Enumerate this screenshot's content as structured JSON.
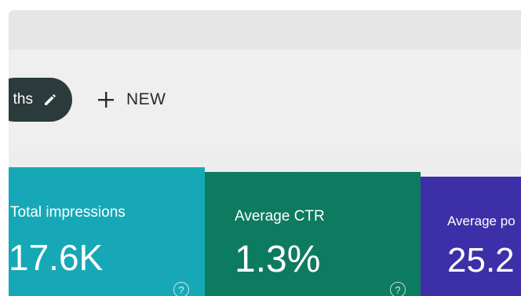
{
  "toolbar": {
    "filter_chip_label": "ths",
    "new_button_label": "NEW"
  },
  "cards": [
    {
      "label": "Total impressions",
      "value": "17.6K",
      "color": "#16a8b7"
    },
    {
      "label": "Average CTR",
      "value": "1.3%",
      "color": "#0d7b5f"
    },
    {
      "label": "Average po",
      "value": "25.2",
      "color": "#3d2fa8"
    }
  ],
  "icons": {
    "edit": "pencil-icon",
    "add": "plus-icon",
    "help": "help-icon"
  }
}
